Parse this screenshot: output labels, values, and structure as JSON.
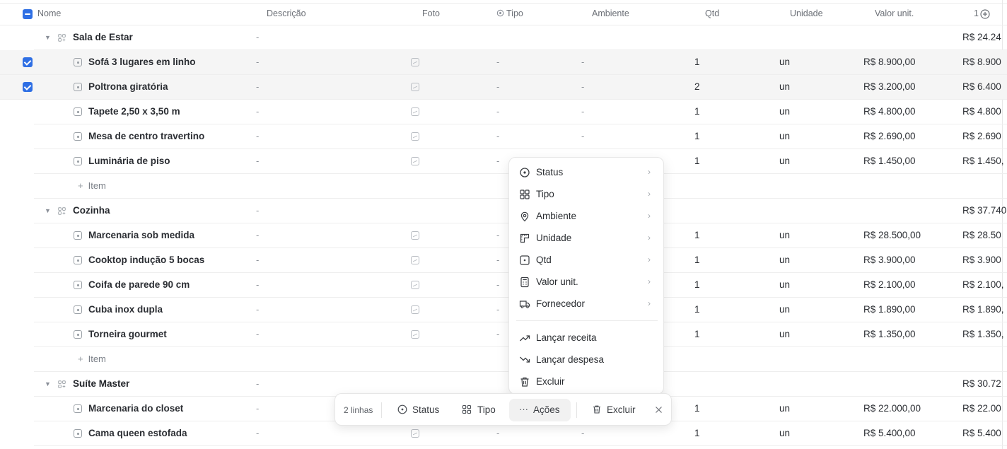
{
  "columns": {
    "name": "Nome",
    "description": "Descrição",
    "photo": "Foto",
    "type": "Tipo",
    "environment": "Ambiente",
    "qty": "Qtd",
    "unit": "Unidade",
    "unit_value": "Valor unit.",
    "total_partial": "1",
    "add_column_icon": "plus-circle-icon"
  },
  "rows": [
    {
      "kind": "group",
      "name": "Sala de Estar",
      "description": "-",
      "total": "R$ 24.24"
    },
    {
      "kind": "item",
      "selected": true,
      "name": "Sofá 3 lugares em linho",
      "description": "-",
      "type": "-",
      "environment": "-",
      "qty": "1",
      "unit": "un",
      "unit_value": "R$ 8.900,00",
      "total": "R$ 8.900"
    },
    {
      "kind": "item",
      "selected": true,
      "name": "Poltrona giratória",
      "description": "-",
      "type": "-",
      "environment": "-",
      "qty": "2",
      "unit": "un",
      "unit_value": "R$ 3.200,00",
      "total": "R$ 6.400"
    },
    {
      "kind": "item",
      "selected": false,
      "name": "Tapete 2,50 x 3,50 m",
      "description": "-",
      "type": "-",
      "environment": "-",
      "qty": "1",
      "unit": "un",
      "unit_value": "R$ 4.800,00",
      "total": "R$ 4.800"
    },
    {
      "kind": "item",
      "selected": false,
      "name": "Mesa de centro travertino",
      "description": "-",
      "type": "-",
      "environment": "-",
      "qty": "1",
      "unit": "un",
      "unit_value": "R$ 2.690,00",
      "total": "R$ 2.690"
    },
    {
      "kind": "item",
      "selected": false,
      "name": "Luminária de piso",
      "description": "-",
      "type": "-",
      "environment": "",
      "qty": "1",
      "unit": "un",
      "unit_value": "R$ 1.450,00",
      "total": "R$ 1.450,"
    },
    {
      "kind": "add",
      "label": "Item"
    },
    {
      "kind": "group",
      "name": "Cozinha",
      "description": "-",
      "total": "R$ 37.740"
    },
    {
      "kind": "item",
      "selected": false,
      "name": "Marcenaria sob medida",
      "description": "-",
      "type": "-",
      "environment": "",
      "qty": "1",
      "unit": "un",
      "unit_value": "R$ 28.500,00",
      "total": "R$ 28.50"
    },
    {
      "kind": "item",
      "selected": false,
      "name": "Cooktop indução 5 bocas",
      "description": "-",
      "type": "-",
      "environment": "",
      "qty": "1",
      "unit": "un",
      "unit_value": "R$ 3.900,00",
      "total": "R$ 3.900"
    },
    {
      "kind": "item",
      "selected": false,
      "name": "Coifa de parede 90 cm",
      "description": "-",
      "type": "-",
      "environment": "",
      "qty": "1",
      "unit": "un",
      "unit_value": "R$ 2.100,00",
      "total": "R$ 2.100,"
    },
    {
      "kind": "item",
      "selected": false,
      "name": "Cuba inox dupla",
      "description": "-",
      "type": "-",
      "environment": "",
      "qty": "1",
      "unit": "un",
      "unit_value": "R$ 1.890,00",
      "total": "R$ 1.890,"
    },
    {
      "kind": "item",
      "selected": false,
      "name": "Torneira gourmet",
      "description": "-",
      "type": "-",
      "environment": "",
      "qty": "1",
      "unit": "un",
      "unit_value": "R$ 1.350,00",
      "total": "R$ 1.350,"
    },
    {
      "kind": "add",
      "label": "Item"
    },
    {
      "kind": "group",
      "name": "Suíte Master",
      "description": "-",
      "total": "R$ 30.72"
    },
    {
      "kind": "item",
      "selected": false,
      "name": "Marcenaria do closet",
      "description": "-",
      "type": "",
      "environment": "",
      "qty": "1",
      "unit": "un",
      "unit_value": "R$ 22.000,00",
      "total": "R$ 22.00"
    },
    {
      "kind": "item",
      "selected": false,
      "name": "Cama queen estofada",
      "description": "-",
      "type": "-",
      "environment": "-",
      "qty": "1",
      "unit": "un",
      "unit_value": "R$ 5.400,00",
      "total": "R$ 5.400"
    }
  ],
  "menu": {
    "items": [
      {
        "label": "Status",
        "icon": "status-circle-icon",
        "submenu": true
      },
      {
        "label": "Tipo",
        "icon": "grid-icon",
        "submenu": true
      },
      {
        "label": "Ambiente",
        "icon": "location-pin-icon",
        "submenu": true
      },
      {
        "label": "Unidade",
        "icon": "ruler-icon",
        "submenu": true
      },
      {
        "label": "Qtd",
        "icon": "quantity-icon",
        "submenu": true
      },
      {
        "label": "Valor unit.",
        "icon": "calculator-icon",
        "submenu": true
      },
      {
        "label": "Fornecedor",
        "icon": "truck-icon",
        "submenu": true
      },
      {
        "label": "Lançar receita",
        "icon": "trend-up-icon",
        "submenu": false
      },
      {
        "label": "Lançar despesa",
        "icon": "trend-down-icon",
        "submenu": false
      },
      {
        "label": "Excluir",
        "icon": "trash-icon",
        "submenu": false
      }
    ]
  },
  "action_bar": {
    "count": "2 linhas",
    "status": "Status",
    "type": "Tipo",
    "actions": "Ações",
    "delete": "Excluir"
  },
  "colors": {
    "accent": "#2f6fe4",
    "selected_row": "#f5f5f5"
  }
}
